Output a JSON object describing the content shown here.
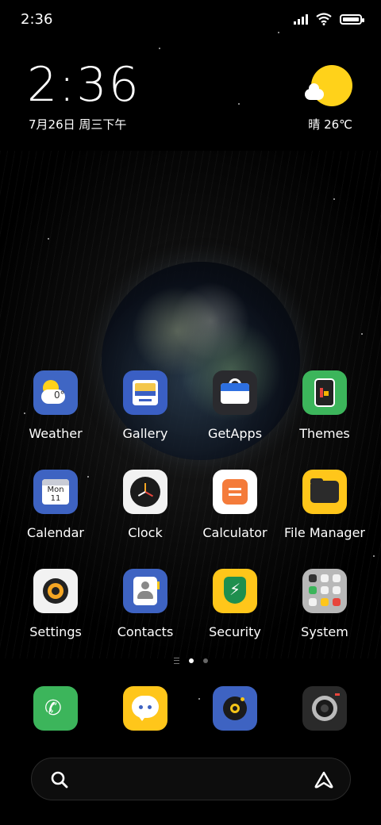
{
  "status_bar": {
    "time": "2:36"
  },
  "clock_widget": {
    "time": "2:36",
    "date": "7月26日 周三下午"
  },
  "weather_widget": {
    "text": "晴 26℃"
  },
  "apps": [
    {
      "id": "weather",
      "label": "Weather",
      "icon": "weather-icon",
      "badge": "0°"
    },
    {
      "id": "gallery",
      "label": "Gallery",
      "icon": "gallery-icon"
    },
    {
      "id": "getapps",
      "label": "GetApps",
      "icon": "shopping-bag-icon"
    },
    {
      "id": "themes",
      "label": "Themes",
      "icon": "themes-icon"
    },
    {
      "id": "calendar",
      "label": "Calendar",
      "icon": "calendar-icon",
      "day": "Mon",
      "date": "11"
    },
    {
      "id": "clock",
      "label": "Clock",
      "icon": "clock-icon"
    },
    {
      "id": "calculator",
      "label": "Calculator",
      "icon": "calculator-icon"
    },
    {
      "id": "filemanager",
      "label": "File Manager",
      "icon": "folder-icon"
    },
    {
      "id": "settings",
      "label": "Settings",
      "icon": "gear-icon"
    },
    {
      "id": "contacts",
      "label": "Contacts",
      "icon": "contacts-icon"
    },
    {
      "id": "security",
      "label": "Security",
      "icon": "shield-icon"
    },
    {
      "id": "system",
      "label": "System",
      "icon": "folder-grid-icon"
    }
  ],
  "dock": [
    {
      "id": "phone",
      "icon": "phone-icon"
    },
    {
      "id": "messaging",
      "icon": "chat-bubble-icon"
    },
    {
      "id": "music",
      "icon": "music-icon"
    },
    {
      "id": "camera",
      "icon": "camera-icon"
    }
  ],
  "pager": {
    "pages": 2,
    "current": 1
  },
  "colors": {
    "sun": "#ffd21a",
    "background": "#000000"
  }
}
